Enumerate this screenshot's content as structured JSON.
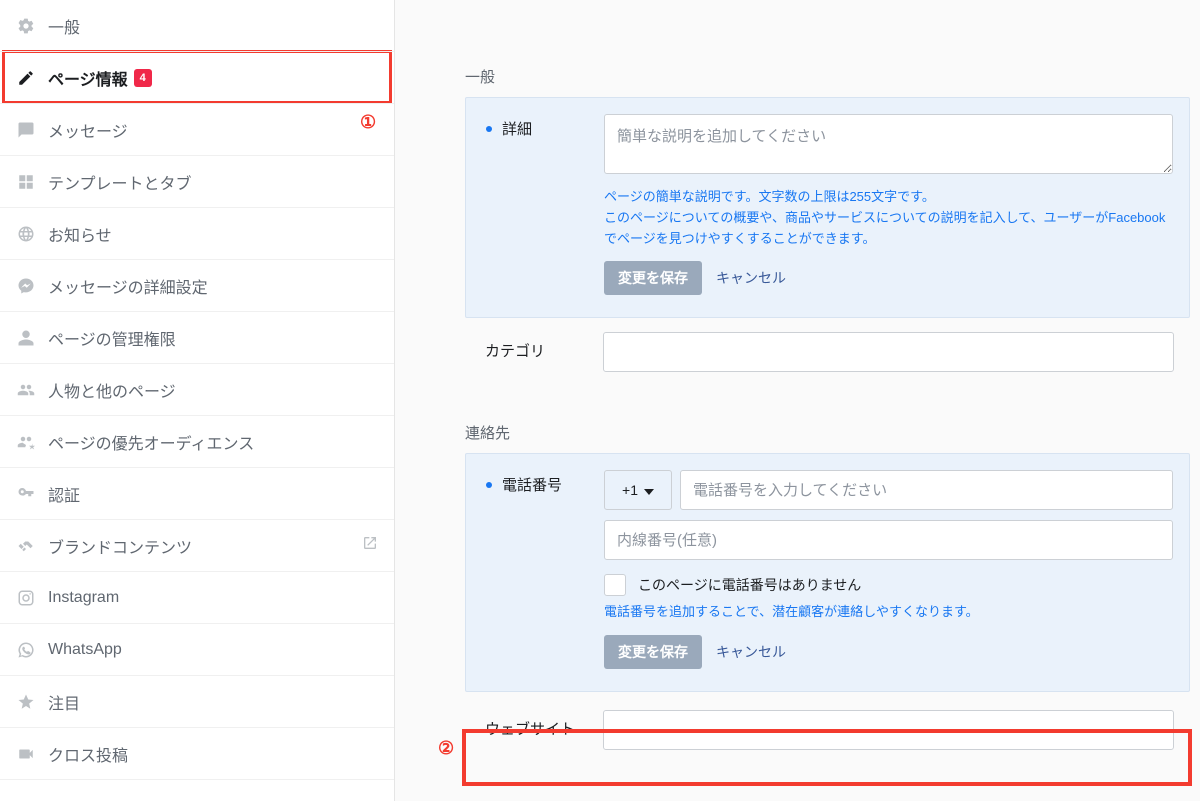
{
  "annotations": {
    "circ1": "①",
    "circ2": "②"
  },
  "sidebar": {
    "items": [
      {
        "label": "一般",
        "icon": "gear"
      },
      {
        "label": "ページ情報",
        "icon": "pencil",
        "badge": "4",
        "active": true
      },
      {
        "label": "メッセージ",
        "icon": "chat"
      },
      {
        "label": "テンプレートとタブ",
        "icon": "grid"
      },
      {
        "label": "お知らせ",
        "icon": "globe"
      },
      {
        "label": "メッセージの詳細設定",
        "icon": "messenger"
      },
      {
        "label": "ページの管理権限",
        "icon": "person"
      },
      {
        "label": "人物と他のページ",
        "icon": "people"
      },
      {
        "label": "ページの優先オーディエンス",
        "icon": "people-star"
      },
      {
        "label": "認証",
        "icon": "key"
      },
      {
        "label": "ブランドコンテンツ",
        "icon": "handshake",
        "arrow": true
      },
      {
        "label": "Instagram",
        "icon": "instagram"
      },
      {
        "label": "WhatsApp",
        "icon": "whatsapp"
      },
      {
        "label": "注目",
        "icon": "star"
      },
      {
        "label": "クロス投稿",
        "icon": "video"
      }
    ]
  },
  "main": {
    "sections": {
      "general": {
        "title": "一般",
        "details": {
          "label": "詳細",
          "placeholder": "簡単な説明を追加してください",
          "help": "ページの簡単な説明です。文字数の上限は255文字です。\nこのページについての概要や、商品やサービスについての説明を記入して、ユーザーがFacebookでページを見つけやすくすることができます。",
          "save": "変更を保存",
          "cancel": "キャンセル"
        },
        "category": {
          "label": "カテゴリ"
        }
      },
      "contact": {
        "title": "連絡先",
        "phone": {
          "label": "電話番号",
          "cc": "+1",
          "placeholder_num": "電話番号を入力してください",
          "placeholder_ext": "内線番号(任意)",
          "no_phone": "このページに電話番号はありません",
          "help": "電話番号を追加することで、潜在顧客が連絡しやすくなります。",
          "save": "変更を保存",
          "cancel": "キャンセル"
        },
        "website": {
          "label": "ウェブサイト"
        }
      }
    }
  }
}
